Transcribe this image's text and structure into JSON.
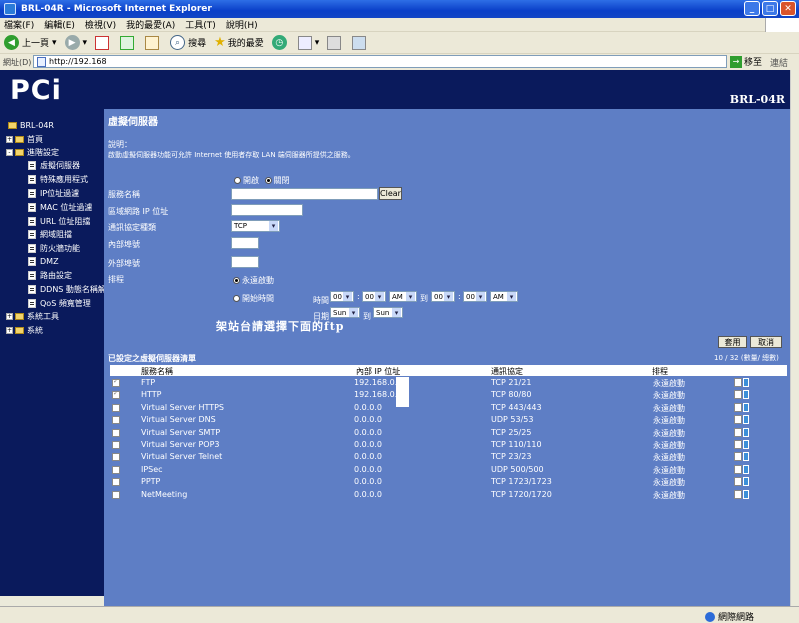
{
  "window": {
    "title": "BRL-04R - Microsoft Internet Explorer"
  },
  "menu": [
    "檔案(F)",
    "編輯(E)",
    "檢視(V)",
    "我的最愛(A)",
    "工具(T)",
    "說明(H)"
  ],
  "toolbar": {
    "back": "上一頁",
    "search": "搜尋",
    "favorites": "我的最愛"
  },
  "address": {
    "label": "網址(D)",
    "url": "http://192.168",
    "go": "移至",
    "links": "連結"
  },
  "header": {
    "logo": "PCi",
    "model": "BRL-04R"
  },
  "sidebar": {
    "root": "BRL-04R",
    "home": "首頁",
    "advanced": "進階設定",
    "items": [
      "虛擬伺服器",
      "特殊應用程式",
      "IP位址過濾",
      "MAC 位址過濾",
      "URL 位址阻擋",
      "網域阻擋",
      "防火牆功能",
      "DMZ",
      "路由設定",
      "DDNS 動態名稱解析",
      "QoS 頻寬管理"
    ],
    "tools": "系統工具",
    "system": "系統"
  },
  "page": {
    "title": "虛擬伺服器",
    "desc_label": "說明：",
    "desc_text": "啟動虛擬伺服器功能可允許 Internet 使用者存取 LAN 端伺服器所提供之服務。"
  },
  "form": {
    "enable": "開啟",
    "disable": "關閉",
    "server_name": "服務名稱",
    "clear": "Clear",
    "lan_ip": "區域網路 IP 位址",
    "protocol_type": "通訊協定種類",
    "protocol_value": "TCP",
    "internal_port": "內部埠號",
    "external_port": "外部埠號",
    "schedule": "排程",
    "always": "永遠啟動",
    "start_time": "開始時間",
    "time": "時間",
    "to": "到",
    "date": "日期",
    "hour1": "00",
    "min1": "00",
    "ampm1": "AM",
    "hour2": "00",
    "min2": "00",
    "ampm2": "AM",
    "day1": "Sun",
    "day2": "Sun",
    "apply": "套用",
    "cancel": "取消"
  },
  "annotation": "架站台請選擇下面的ftp",
  "list": {
    "title": "已設定之虛擬伺服器清單",
    "count": "10 / 32 (數量/ 總數)",
    "headers": {
      "name": "服務名稱",
      "ip": "內部 IP 位址",
      "protocol": "通訊協定",
      "schedule": "排程"
    },
    "rows": [
      {
        "name": "FTP",
        "ip": "192.168.0.",
        "protocol": "TCP 21/21",
        "schedule": "永遠啟動",
        "checked": true
      },
      {
        "name": "HTTP",
        "ip": "192.168.0.",
        "protocol": "TCP 80/80",
        "schedule": "永遠啟動",
        "checked": true
      },
      {
        "name": "Virtual Server HTTPS",
        "ip": "0.0.0.0",
        "protocol": "TCP 443/443",
        "schedule": "永遠啟動",
        "checked": false
      },
      {
        "name": "Virtual Server DNS",
        "ip": "0.0.0.0",
        "protocol": "UDP 53/53",
        "schedule": "永遠啟動",
        "checked": false
      },
      {
        "name": "Virtual Server SMTP",
        "ip": "0.0.0.0",
        "protocol": "TCP 25/25",
        "schedule": "永遠啟動",
        "checked": false
      },
      {
        "name": "Virtual Server POP3",
        "ip": "0.0.0.0",
        "protocol": "TCP 110/110",
        "schedule": "永遠啟動",
        "checked": false
      },
      {
        "name": "Virtual Server Telnet",
        "ip": "0.0.0.0",
        "protocol": "TCP 23/23",
        "schedule": "永遠啟動",
        "checked": false
      },
      {
        "name": "IPSec",
        "ip": "0.0.0.0",
        "protocol": "UDP 500/500",
        "schedule": "永遠啟動",
        "checked": false
      },
      {
        "name": "PPTP",
        "ip": "0.0.0.0",
        "protocol": "TCP 1723/1723",
        "schedule": "永遠啟動",
        "checked": false
      },
      {
        "name": "NetMeeting",
        "ip": "0.0.0.0",
        "protocol": "TCP 1720/1720",
        "schedule": "永遠啟動",
        "checked": false
      }
    ]
  },
  "status": {
    "zone": "網際網路"
  }
}
